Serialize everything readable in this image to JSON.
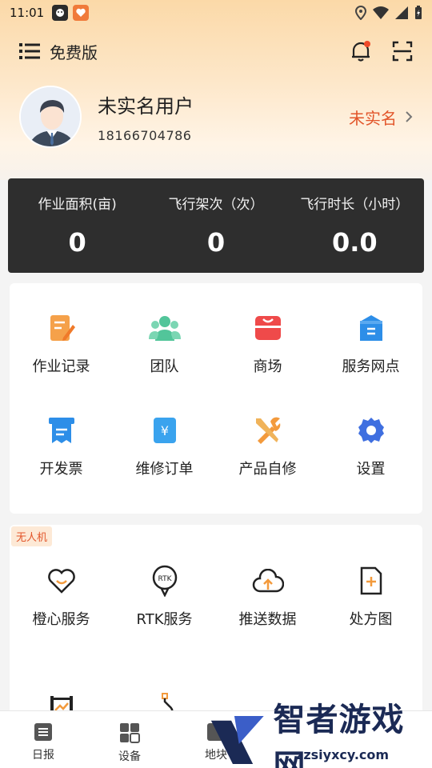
{
  "status_bar": {
    "time": "11:01"
  },
  "header": {
    "edition": "免费版"
  },
  "profile": {
    "name": "未实名用户",
    "phone": "18166704786",
    "verify_label": "未实名"
  },
  "stats": [
    {
      "label": "作业面积(亩)",
      "value": "0"
    },
    {
      "label": "飞行架次（次）",
      "value": "0"
    },
    {
      "label": "飞行时长（小时）",
      "value": "0.0"
    }
  ],
  "menu1": [
    {
      "label": "作业记录",
      "icon": "notepad-icon",
      "color": "#f5a14a"
    },
    {
      "label": "团队",
      "icon": "team-icon",
      "color": "#52c59a"
    },
    {
      "label": "商场",
      "icon": "store-icon",
      "color": "#ef4a4a"
    },
    {
      "label": "服务网点",
      "icon": "service-point-icon",
      "color": "#2d8ee8"
    },
    {
      "label": "开发票",
      "icon": "invoice-icon",
      "color": "#2d8ee8"
    },
    {
      "label": "维修订单",
      "icon": "repair-order-icon",
      "color": "#3aa3ee"
    },
    {
      "label": "产品自修",
      "icon": "tools-icon",
      "color": "#f39a3c"
    },
    {
      "label": "设置",
      "icon": "settings-gear-icon",
      "color": "#3f6fe0"
    }
  ],
  "drone_section": {
    "badge": "无人机",
    "items": [
      {
        "label": "橙心服务",
        "icon": "heart-smile-icon"
      },
      {
        "label": "RTK服务",
        "icon": "rtk-icon",
        "icon_text": "RTK"
      },
      {
        "label": "推送数据",
        "icon": "cloud-upload-icon"
      },
      {
        "label": "处方图",
        "icon": "prescription-doc-icon"
      }
    ],
    "partial_items": [
      {
        "icon": "calibration-frame-icon"
      },
      {
        "icon": "hook-icon"
      }
    ]
  },
  "tabbar": [
    {
      "label": "日报",
      "icon": "report-icon"
    },
    {
      "label": "设备",
      "icon": "device-grid-icon"
    },
    {
      "label": "地块",
      "icon": "plot-icon"
    }
  ],
  "watermark": {
    "text": "智者游戏网",
    "sub": "zzsiyxcy.com"
  }
}
